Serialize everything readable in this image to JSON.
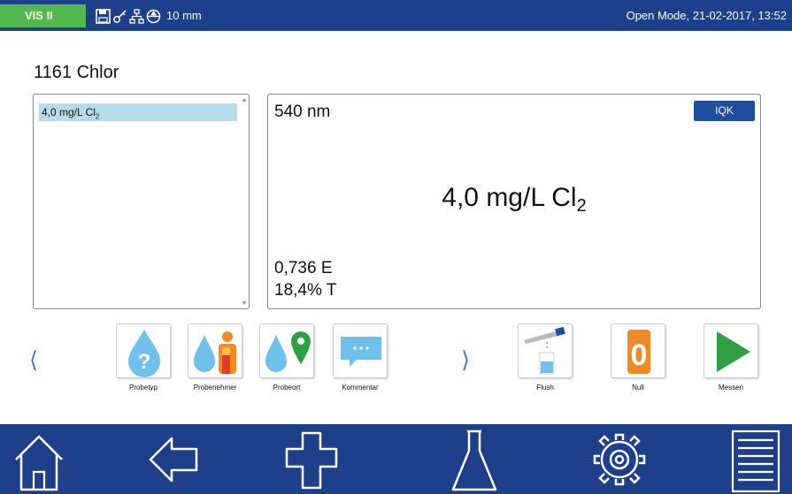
{
  "status_bar": {
    "instrument": "VIS II",
    "path_length": "10 mm",
    "mode_datetime": "Open Mode, 21-02-2017, 13:52",
    "icons": [
      "save-icon",
      "key-icon",
      "network-icon",
      "cuvette-icon"
    ]
  },
  "test_title": "1161 Chlor",
  "list": {
    "items": [
      {
        "value": "4,0 mg/L Cl",
        "sub": "2"
      }
    ]
  },
  "result": {
    "wavelength": "540 nm",
    "iqk_label": "IQK",
    "value": "4,0 mg/L Cl",
    "value_sub": "2",
    "extinction": "0,736 E",
    "transmission": "18,4% T"
  },
  "tools": [
    {
      "label": "Probetyp",
      "icon": "sample-type-icon"
    },
    {
      "label": "Probenehmer",
      "icon": "sampler-icon"
    },
    {
      "label": "Probeort",
      "icon": "sample-location-icon"
    },
    {
      "label": "Kommentar",
      "icon": "comment-icon"
    },
    {
      "label": "Flush",
      "icon": "flush-icon"
    },
    {
      "label": "Null",
      "icon": "zero-icon"
    },
    {
      "label": "Messen",
      "icon": "measure-play-icon"
    }
  ],
  "nav_arrows": {
    "prev": "⟨",
    "next": "⟩"
  },
  "bottom_nav": [
    "home-icon",
    "back-arrow-icon",
    "add-icon",
    "flask-icon",
    "settings-gear-icon",
    "menu-list-icon"
  ],
  "colors": {
    "bar_blue": "#1e3f8a",
    "instrument_green": "#53b84b",
    "selection_blue": "#b7dbe8",
    "iqk_blue": "#1e4ea0",
    "arrow_blue": "#4a82c9",
    "zero_orange": "#f08a24",
    "play_green": "#2ea043"
  }
}
